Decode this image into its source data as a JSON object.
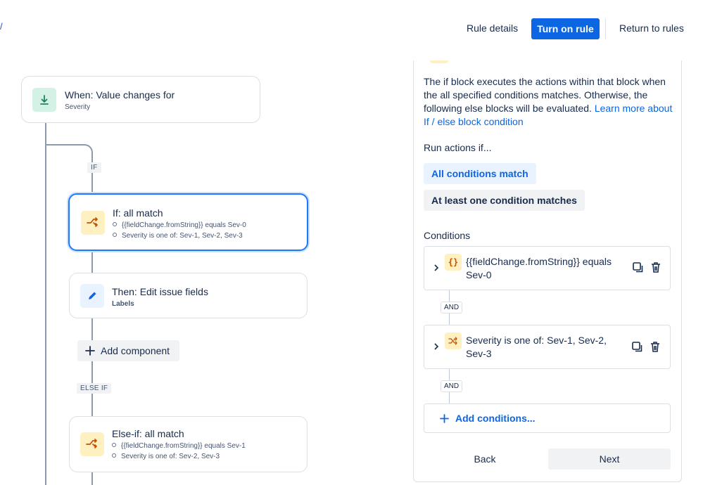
{
  "header": {
    "rule_details": "Rule details",
    "turn_on": "Turn on rule",
    "return": "Return to rules",
    "edge_glyph": "/"
  },
  "canvas": {
    "trigger": {
      "title": "When: Value changes for",
      "subtitle": "Severity",
      "icon": "download-arrow-icon"
    },
    "if_tag": "IF",
    "if_block": {
      "title": "If: all match",
      "conditions": [
        "{{fieldChange.fromString}} equals Sev-0",
        "Severity is one of: Sev-1, Sev-2, Sev-3"
      ],
      "icon": "branch-icon"
    },
    "then_block": {
      "title": "Then: Edit issue fields",
      "subtitle": "Labels",
      "icon": "pencil-icon"
    },
    "add_component": "Add component",
    "else_if_tag": "ELSE IF",
    "else_if_block": {
      "title": "Else-if: all match",
      "conditions": [
        "{{fieldChange.fromString}} equals Sev-1",
        "Severity is one of: Sev-2, Sev-3"
      ],
      "icon": "branch-icon"
    }
  },
  "panel": {
    "description": "The if block executes the actions within that block when the all specified conditions matches. Otherwise, the following else blocks will be evaluated.",
    "learn_more": "Learn more about If / else block condition",
    "run_actions_label": "Run actions if...",
    "options": [
      {
        "label": "All conditions match",
        "selected": true
      },
      {
        "label": "At least one condition matches",
        "selected": false
      }
    ],
    "conditions_label": "Conditions",
    "conditions": [
      {
        "text": "{{fieldChange.fromString}} equals Sev-0",
        "icon": "curly-braces-icon"
      },
      {
        "text": "Severity is one of: Sev-1, Sev-2, Sev-3",
        "icon": "shuffle-icon"
      }
    ],
    "and_label": "AND",
    "add_conditions": "Add conditions...",
    "back": "Back",
    "next": "Next"
  },
  "colors": {
    "brand": "#0c66e4",
    "selected_border": "#1d7afc",
    "warning_bg": "#fff0c2",
    "success_bg": "#d3f1e5"
  }
}
